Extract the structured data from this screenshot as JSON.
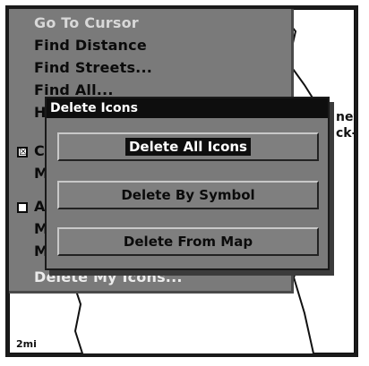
{
  "menu": {
    "items": [
      {
        "label": "Go To Cursor",
        "state": "dim",
        "checkbox": null
      },
      {
        "label": "Find Distance",
        "state": "normal",
        "checkbox": null
      },
      {
        "label": "Find Streets...",
        "state": "normal",
        "checkbox": null
      },
      {
        "label": "Find All...",
        "state": "normal",
        "checkbox": null
      },
      {
        "label": "H",
        "state": "normal",
        "checkbox": null
      },
      {
        "label": "C",
        "state": "normal",
        "checkbox": "checked"
      },
      {
        "label": "M",
        "state": "normal",
        "checkbox": null
      },
      {
        "label": "A",
        "state": "normal",
        "checkbox": "unchecked"
      },
      {
        "label": "M",
        "state": "normal",
        "checkbox": null
      },
      {
        "label": "M",
        "state": "normal",
        "checkbox": null
      },
      {
        "label": "Delete My Icons...",
        "state": "selected",
        "checkbox": null
      }
    ]
  },
  "dialog": {
    "title": "Delete Icons",
    "buttons": [
      {
        "label": "Delete All Icons",
        "active": true
      },
      {
        "label": "Delete By Symbol",
        "active": false
      },
      {
        "label": "Delete From Map",
        "active": false
      }
    ]
  },
  "map": {
    "label_lines": [
      "ney",
      "ck-"
    ],
    "scale": "2mi"
  },
  "icons": {
    "checked": "☒",
    "unchecked": ""
  }
}
